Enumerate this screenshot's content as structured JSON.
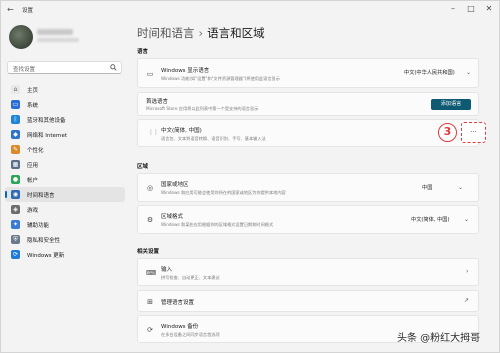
{
  "app": {
    "title": "设置"
  },
  "sidebar": {
    "search_placeholder": "查找设置",
    "items": [
      {
        "label": "主页",
        "icon": "home-icon",
        "color": "#e8e8e8"
      },
      {
        "label": "系统",
        "icon": "system-icon",
        "color": "#2b6fd6"
      },
      {
        "label": "蓝牙和其他设备",
        "icon": "bluetooth-icon",
        "color": "#1f86d6"
      },
      {
        "label": "网络和 Internet",
        "icon": "wifi-icon",
        "color": "#2b74c9"
      },
      {
        "label": "个性化",
        "icon": "brush-icon",
        "color": "#d98b2b"
      },
      {
        "label": "应用",
        "icon": "apps-icon",
        "color": "#5a6f86"
      },
      {
        "label": "帐户",
        "icon": "account-icon",
        "color": "#2da55a"
      },
      {
        "label": "时间和语言",
        "icon": "globe-icon",
        "color": "#2f6bb5"
      },
      {
        "label": "游戏",
        "icon": "gamepad-icon",
        "color": "#6d6d6d"
      },
      {
        "label": "辅助功能",
        "icon": "accessibility-icon",
        "color": "#3a7bd5"
      },
      {
        "label": "隐私和安全性",
        "icon": "shield-icon",
        "color": "#6a7a8a"
      },
      {
        "label": "Windows 更新",
        "icon": "update-icon",
        "color": "#1f7bd6"
      }
    ],
    "active_index": 7
  },
  "header": {
    "parent": "时间和语言",
    "separator": "›",
    "title": "语言和区域"
  },
  "language": {
    "section_label": "语言",
    "display_language": {
      "title": "Windows 显示语言",
      "subtitle": "Windows 功能(如\"设置\"和\"文件资源管理器\")将使用此语言显示",
      "value": "中文(中华人民共和国)"
    },
    "preferred": {
      "title": "首选语言",
      "subtitle": "Microsoft Store 应用将以此列表中第一个受支持的语言显示",
      "button": "添加语言"
    },
    "chinese": {
      "title": "中文(简体, 中国)",
      "subtitle": "语言包、文本到语音转换、语音识别、手写、基本输入法",
      "annotation": "3",
      "more": "···"
    }
  },
  "region": {
    "section_label": "区域",
    "country": {
      "title": "国家或地区",
      "subtitle": "Windows 和应用可能会使用你所在的国家或地区为你提供本地内容",
      "value": "中国"
    },
    "format": {
      "title": "区域格式",
      "subtitle": "Windows 和某些应用根据你的区域格式设置日期和时间格式",
      "value": "中文(简体, 中国)"
    }
  },
  "related": {
    "section_label": "相关设置",
    "input": {
      "title": "输入",
      "subtitle": "拼写检查、自动更正、文本建议"
    },
    "admin": {
      "title": "管理语言设置"
    },
    "backup": {
      "title": "Windows 备份",
      "subtitle": "在多台设备之间同步语言首选项"
    }
  },
  "watermark": {
    "text": "头条 @粉红大拇哥"
  }
}
